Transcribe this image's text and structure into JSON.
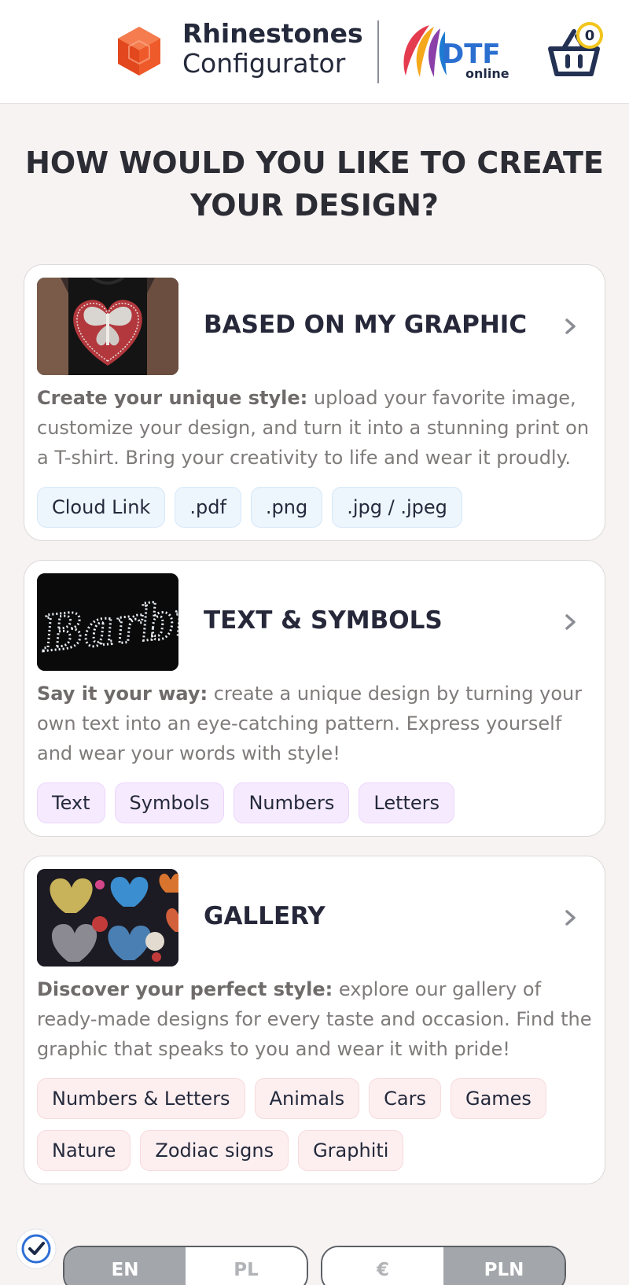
{
  "header": {
    "brand_line1": "Rhinestones",
    "brand_line2": "Configurator",
    "partner_logo": {
      "main": "DTF",
      "sub": "online"
    },
    "cart_count": "0"
  },
  "page_title": "HOW WOULD YOU LIKE TO CREATE YOUR DESIGN?",
  "options": [
    {
      "title": "BASED ON MY GRAPHIC",
      "lead": "Create your unique style:",
      "text": " upload your favorite image, customize your design, and turn it into a stunning print on a T-shirt. Bring your creativity to life and wear it proudly.",
      "tags": [
        "Cloud Link",
        ".pdf",
        ".png",
        ".jpg / .jpeg"
      ]
    },
    {
      "title": "TEXT & SYMBOLS",
      "thumb_text": "Barbie",
      "lead": "Say it your way:",
      "text": " create a unique design by turning your own text into an eye-catching pattern. Express yourself and wear your words with style!",
      "tags": [
        "Text",
        "Symbols",
        "Numbers",
        "Letters"
      ]
    },
    {
      "title": "GALLERY",
      "lead": "Discover your perfect style:",
      "text": " explore our gallery of ready-made designs for every taste and occasion. Find the graphic that speaks to you and wear it with pride!",
      "tags": [
        "Numbers & Letters",
        "Animals",
        "Cars",
        "Games",
        "Nature",
        "Zodiac signs",
        "Graphiti"
      ]
    }
  ],
  "language_toggle": {
    "options": [
      "EN",
      "PL"
    ],
    "selected": "EN"
  },
  "currency_toggle": {
    "options": [
      "€",
      "PLN"
    ],
    "selected": "PLN"
  },
  "icons": {
    "logo": "cube-logo-icon",
    "cart": "shopping-basket-icon",
    "arrow": "chevron-right-icon",
    "verify": "verified-check-icon"
  },
  "colors": {
    "brand_orange": "#ef5a2b",
    "cart_badge_border": "#f2c51d",
    "tag_blue": "#edf5fd",
    "tag_purple": "#f6eafe",
    "tag_pink": "#fdeff0",
    "toggle_active": "#a3a6aa"
  }
}
